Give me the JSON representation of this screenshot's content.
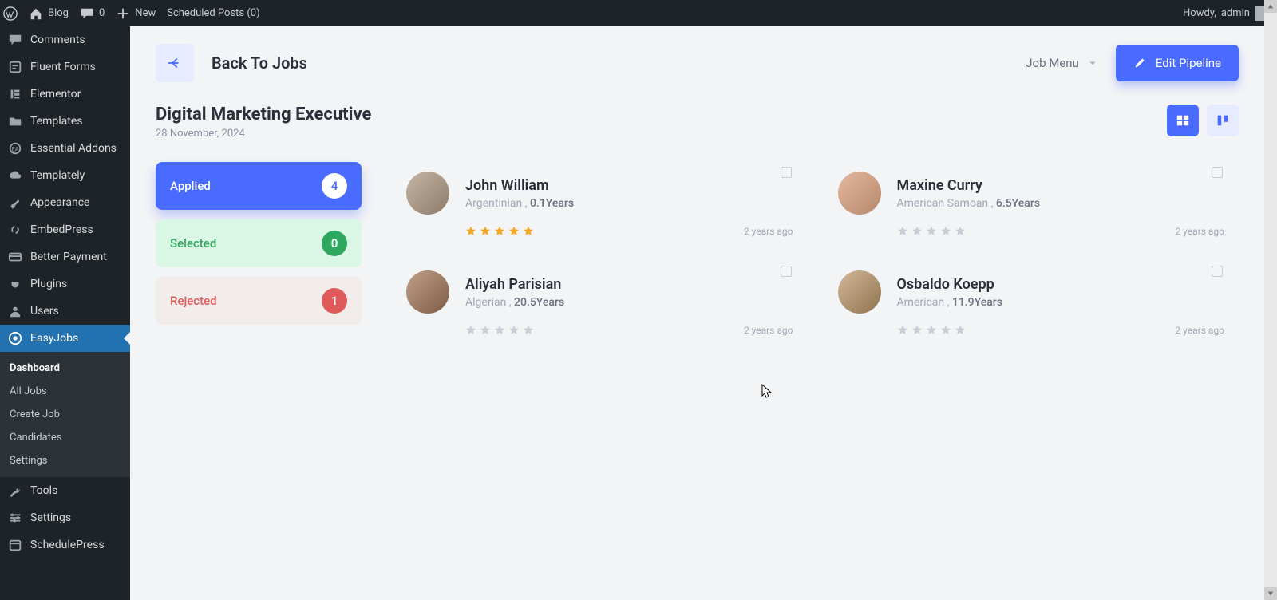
{
  "adminbar": {
    "blog": "Blog",
    "comments_count": "0",
    "new": "New",
    "scheduled": "Scheduled Posts (0)",
    "howdy": "Howdy,",
    "user": "admin"
  },
  "sidebar": {
    "items": [
      {
        "label": "Comments"
      },
      {
        "label": "Fluent Forms"
      },
      {
        "label": "Elementor"
      },
      {
        "label": "Templates"
      },
      {
        "label": "Essential Addons"
      },
      {
        "label": "Templately"
      },
      {
        "label": "Appearance"
      },
      {
        "label": "EmbedPress"
      },
      {
        "label": "Better Payment"
      },
      {
        "label": "Plugins"
      },
      {
        "label": "Users"
      },
      {
        "label": "EasyJobs"
      },
      {
        "label": "Tools"
      },
      {
        "label": "Settings"
      },
      {
        "label": "SchedulePress"
      }
    ],
    "sub": [
      {
        "label": "Dashboard"
      },
      {
        "label": "All Jobs"
      },
      {
        "label": "Create Job"
      },
      {
        "label": "Candidates"
      },
      {
        "label": "Settings"
      }
    ]
  },
  "topbar": {
    "back": "Back To Jobs",
    "job_menu": "Job Menu",
    "edit_pipeline": "Edit Pipeline"
  },
  "job": {
    "title": "Digital Marketing Executive",
    "date": "28 November, 2024"
  },
  "pipeline": {
    "applied": {
      "label": "Applied",
      "count": "4"
    },
    "selected": {
      "label": "Selected",
      "count": "0"
    },
    "rejected": {
      "label": "Rejected",
      "count": "1"
    }
  },
  "candidates": [
    {
      "name": "John William",
      "nationality": "Argentinian",
      "sep": " , ",
      "years": "0.1Years",
      "rating": 5,
      "ago": "2 years ago"
    },
    {
      "name": "Maxine Curry",
      "nationality": "American Samoan",
      "sep": " , ",
      "years": "6.5Years",
      "rating": 0,
      "ago": "2 years ago"
    },
    {
      "name": "Aliyah Parisian",
      "nationality": "Algerian",
      "sep": " , ",
      "years": "20.5Years",
      "rating": 0,
      "ago": "2 years ago"
    },
    {
      "name": "Osbaldo Koepp",
      "nationality": "American",
      "sep": " , ",
      "years": "11.9Years",
      "rating": 0,
      "ago": "2 years ago"
    }
  ]
}
